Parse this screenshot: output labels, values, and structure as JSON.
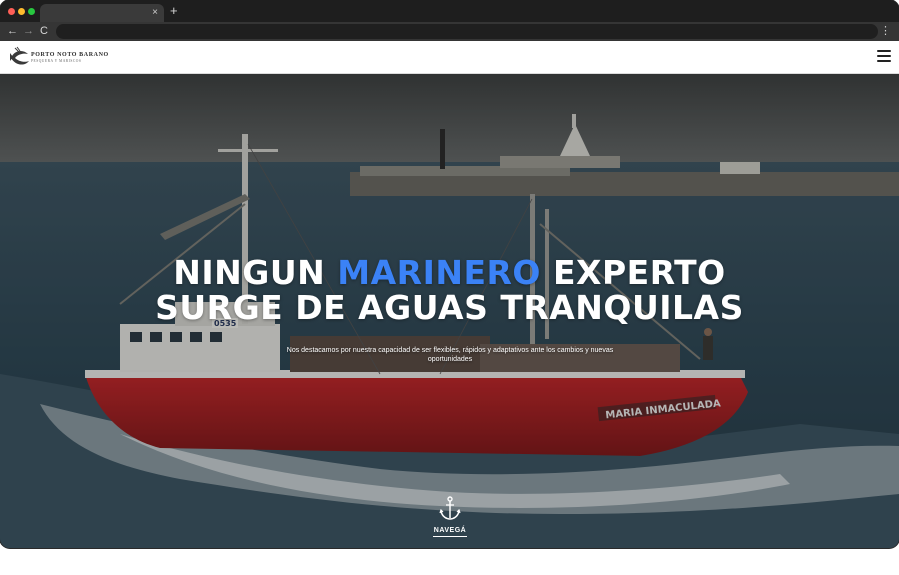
{
  "browser": {
    "tab_close": "×",
    "new_tab": "+",
    "nav_back": "←",
    "nav_forward": "→",
    "nav_reload": "C",
    "menu": "⋮",
    "address": ""
  },
  "header": {
    "logo_title": "PORTO NOTO BARANO",
    "logo_subtitle": "PESQUERA Y MARISCOS"
  },
  "hero": {
    "headline_part1": "NINGUN ",
    "headline_accent": "MARINERO",
    "headline_part2": " EXPERTO",
    "headline_line2": "SURGE DE AGUAS TRANQUILAS",
    "subtext": "Nos destacamos por nuestra capacidad de ser flexibles, rápidos y adaptativos ante los cambios y nuevas oportunidades",
    "cta_label": "NAVEGÁ",
    "boat_name": "MARIA INMACULADA",
    "boat_number": "0535"
  },
  "colors": {
    "accent": "#3b82f6",
    "hull_red": "#c0282b"
  },
  "icons": {
    "menu": "hamburger-icon",
    "cta": "anchor-icon",
    "logo": "fish-icon"
  }
}
